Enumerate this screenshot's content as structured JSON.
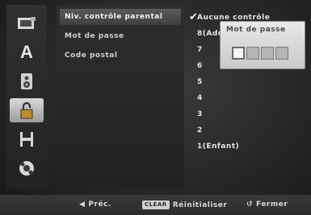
{
  "sidebar": {
    "icons": [
      "disc-icon",
      "language-icon",
      "audio-icon",
      "lock-icon",
      "film-icon",
      "settings-disc-icon"
    ],
    "language_letter": "A",
    "active_index": 3
  },
  "menu": {
    "items": [
      {
        "label": "Niv. contrôle parental"
      },
      {
        "label": "Mot de passe"
      },
      {
        "label": "Code postal"
      }
    ]
  },
  "options": {
    "items": [
      "Aucune contrôle",
      "8(Adulte)",
      "7",
      "6",
      "5",
      "4",
      "3",
      "2",
      "1(Enfant)"
    ],
    "selected_index": 0
  },
  "password_dialog": {
    "title": "Mot de passe",
    "digits": 4,
    "active_digit": 0
  },
  "footer": {
    "prev_label": "Préc.",
    "clear_badge": "CLEAR",
    "reset_label": "Réinitialiser",
    "close_label": "Fermer"
  }
}
